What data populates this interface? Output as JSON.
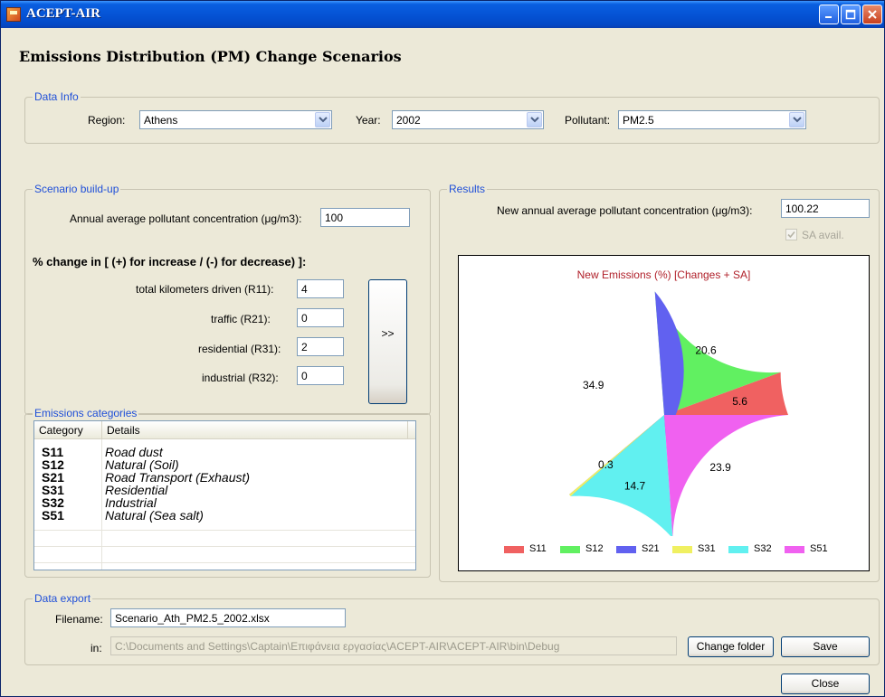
{
  "window": {
    "title": "ACEPT-AIR",
    "heading": "Emissions Distribution (PM) Change Scenarios"
  },
  "data_info": {
    "group_label": "Data Info",
    "region_label": "Region:",
    "region_value": "Athens",
    "year_label": "Year:",
    "year_value": "2002",
    "pollutant_label": "Pollutant:",
    "pollutant_value": "PM2.5"
  },
  "scenario": {
    "group_label": "Scenario build-up",
    "conc_label": "Annual average pollutant concentration (μg/m3):",
    "conc_value": "100",
    "change_heading": "% change in [ (+) for increase / (-) for decrease) ]:",
    "rows": [
      {
        "label": "total kilometers driven (R11):",
        "value": "4"
      },
      {
        "label": "traffic (R21):",
        "value": "0"
      },
      {
        "label": "residential (R31):",
        "value": "2"
      },
      {
        "label": "industrial (R32):",
        "value": "0"
      }
    ],
    "run_button": ">>"
  },
  "categories": {
    "group_label": "Emissions categories",
    "columns": [
      "Category",
      "Details"
    ],
    "rows": [
      {
        "code": "S11",
        "detail": "Road dust"
      },
      {
        "code": "S12",
        "detail": "Natural (Soil)"
      },
      {
        "code": "S21",
        "detail": "Road Transport (Exhaust)"
      },
      {
        "code": "S31",
        "detail": "Residential"
      },
      {
        "code": "S32",
        "detail": "Industrial"
      },
      {
        "code": "S51",
        "detail": "Natural (Sea salt)"
      }
    ]
  },
  "results": {
    "group_label": "Results",
    "new_conc_label": "New annual average pollutant concentration (μg/m3):",
    "new_conc_value": "100.22",
    "sa_label": "SA avail.",
    "sa_checked": true
  },
  "chart_data": {
    "type": "pie",
    "title": "New Emissions (%) [Changes + SA]",
    "series": [
      {
        "name": "S11",
        "value": 5.6,
        "color": "#f06161"
      },
      {
        "name": "S12",
        "value": 20.6,
        "color": "#61f061"
      },
      {
        "name": "S21",
        "value": 34.9,
        "color": "#6161f0"
      },
      {
        "name": "S31",
        "value": 0.3,
        "color": "#f0f061"
      },
      {
        "name": "S32",
        "value": 14.7,
        "color": "#61f0f0"
      },
      {
        "name": "S51",
        "value": 23.9,
        "color": "#f061f0"
      }
    ],
    "legend_position": "bottom"
  },
  "export": {
    "group_label": "Data export",
    "filename_label": "Filename:",
    "filename_value": "Scenario_Ath_PM2.5_2002.xlsx",
    "in_label": "in:",
    "folder_value": "C:\\Documents and Settings\\Captain\\Επιφάνεια εργασίας\\ACEPT-AIR\\ACEPT-AIR\\bin\\Debug",
    "change_folder_label": "Change folder",
    "save_label": "Save"
  },
  "footer": {
    "close_label": "Close"
  }
}
